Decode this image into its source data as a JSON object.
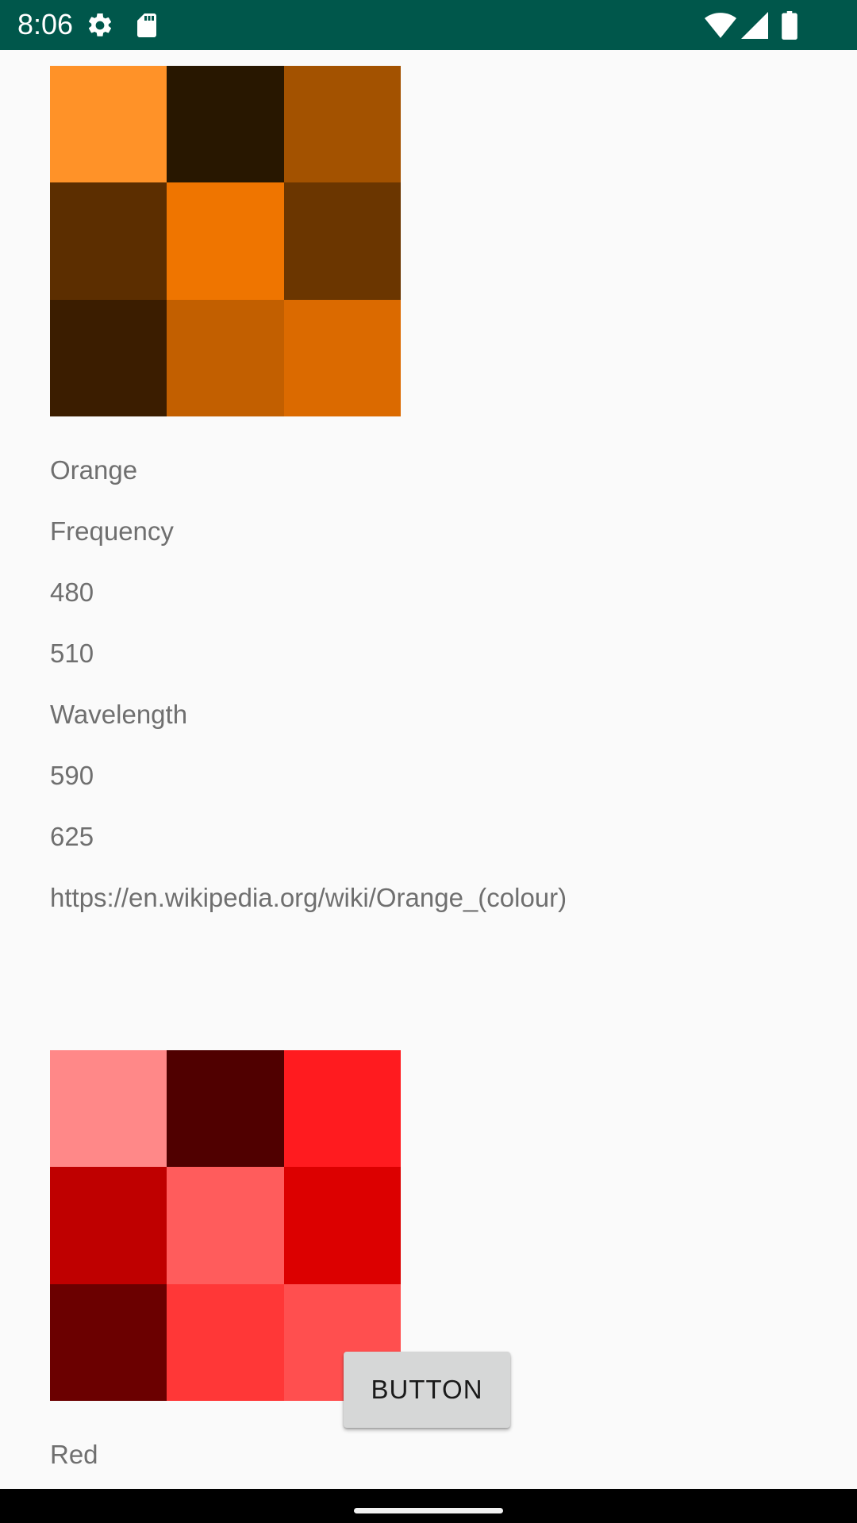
{
  "status_bar": {
    "time": "8:06",
    "background": "#00574b",
    "left_icons": [
      "gear-icon",
      "sd-card-icon"
    ],
    "right_icons": [
      "wifi-icon",
      "cell-signal-icon",
      "battery-icon"
    ]
  },
  "colours": [
    {
      "name": "Orange",
      "frequency_label": "Frequency",
      "frequency_min": "480",
      "frequency_max": "510",
      "wavelength_label": "Wavelength",
      "wavelength_min": "590",
      "wavelength_max": "625",
      "link": "https://en.wikipedia.org/wiki/Orange_(colour)",
      "swatches": [
        "#ff9228",
        "#281700",
        "#a35200",
        "#5c2e00",
        "#ef7500",
        "#6b3600",
        "#3b1d00",
        "#c25f00",
        "#db6a00"
      ]
    },
    {
      "name": "Red",
      "swatches": [
        "#ff8888",
        "#500000",
        "#ff1b1f",
        "#bf0000",
        "#ff5c5c",
        "#dc0000",
        "#6b0000",
        "#ff3737",
        "#ff4f4f"
      ]
    }
  ],
  "button": {
    "label": "BUTTON"
  }
}
